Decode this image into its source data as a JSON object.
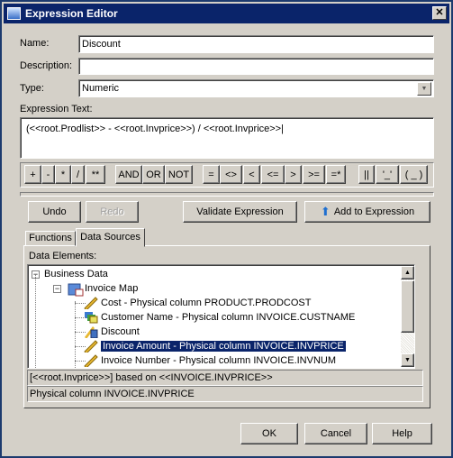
{
  "window": {
    "title": "Expression Editor",
    "close": "✕"
  },
  "form": {
    "name_label": "Name:",
    "name_value": "Discount",
    "description_label": "Description:",
    "description_value": "",
    "type_label": "Type:",
    "type_value": "Numeric",
    "expression_label": "Expression Text:",
    "expression_value": "(<<root.Prodlist>> - <<root.Invprice>>) / <<root.Invprice>>"
  },
  "operators": [
    "+",
    "-",
    "*",
    "/",
    "**",
    "AND",
    "OR",
    "NOT",
    "=",
    "<>",
    "<",
    "<=",
    ">",
    ">=",
    "=*",
    "||",
    "'_'",
    "( _ )"
  ],
  "actions": {
    "undo": "Undo",
    "redo": "Redo",
    "validate": "Validate Expression",
    "add": "Add to Expression"
  },
  "tabs": [
    {
      "label": "Functions",
      "active": false
    },
    {
      "label": "Data Sources",
      "active": true
    }
  ],
  "data_elements_label": "Data Elements:",
  "tree": [
    {
      "label": "Business Data",
      "icon": "none",
      "level": 0,
      "expanded": true
    },
    {
      "label": "Invoice Map",
      "icon": "map-icon",
      "level": 1,
      "expanded": true
    },
    {
      "label": "Cost - Physical column PRODUCT.PRODCOST",
      "icon": "ruler-icon",
      "level": 2
    },
    {
      "label": "Customer Name - Physical column INVOICE.CUSTNAME",
      "icon": "text-column-icon",
      "level": 2
    },
    {
      "label": "Discount",
      "icon": "calculated-column-icon",
      "level": 2
    },
    {
      "label": "Invoice Amount - Physical column INVOICE.INVPRICE",
      "icon": "ruler-icon",
      "level": 2,
      "selected": true
    },
    {
      "label": "Invoice Number - Physical column INVOICE.INVNUM",
      "icon": "ruler-icon",
      "level": 2
    }
  ],
  "status": {
    "line1": "[<<root.Invprice>>] based on <<INVOICE.INVPRICE>>",
    "line2": "Physical column INVOICE.INVPRICE"
  },
  "footer": {
    "ok": "OK",
    "cancel": "Cancel",
    "help": "Help"
  },
  "colors": {
    "titlebar": "#0a246a",
    "face": "#d4d0c8",
    "selection": "#0a246a"
  }
}
